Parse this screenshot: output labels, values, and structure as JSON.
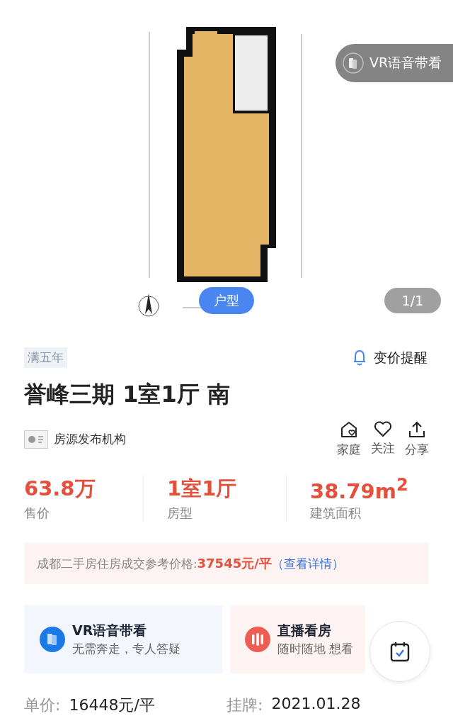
{
  "gallery": {
    "vr_button": "VR语音带看",
    "tabs": [
      {
        "label": "户型",
        "selected": true
      }
    ],
    "counter": "1/1"
  },
  "tag": "满五年",
  "price_alert": "变价提醒",
  "title": "誉峰三期 1室1厅 南",
  "publisher": "房源发布机构",
  "actions": [
    {
      "kind": "family",
      "label": "家庭"
    },
    {
      "kind": "follow",
      "label": "关注"
    },
    {
      "kind": "share",
      "label": "分享"
    }
  ],
  "stats": [
    {
      "value": "63.8万",
      "label": "售价"
    },
    {
      "value": "1室1厅",
      "label": "房型"
    },
    {
      "value": "38.79m$^{2}$",
      "label": "建筑面积"
    }
  ],
  "reference": {
    "label": "成都二手房住房成交参考价格:",
    "value": "37545元/平",
    "link": "（查看详情）"
  },
  "cards": [
    {
      "kind": "vr",
      "title": "VR语音带看",
      "subtitle": "无需奔走，专人答疑"
    },
    {
      "kind": "live",
      "title": "直播看房",
      "subtitle": "随时随地 想看"
    }
  ],
  "details": [
    {
      "label": "单价:",
      "value": "16448元/平"
    },
    {
      "label": "挂牌:",
      "value": "2021.01.28"
    }
  ]
}
